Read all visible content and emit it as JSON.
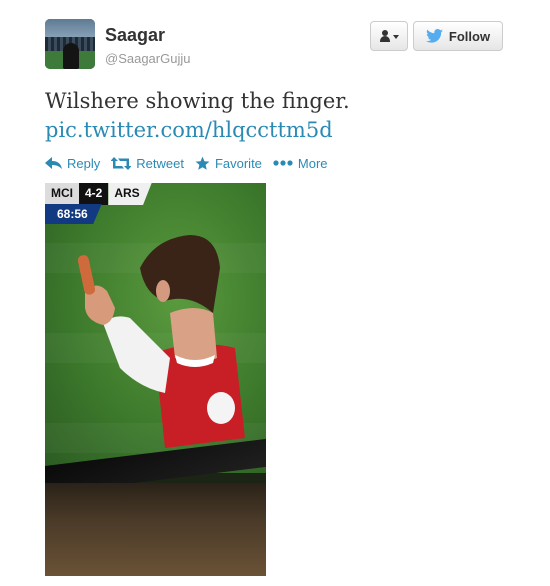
{
  "user": {
    "name": "Saagar",
    "handle": "@SaagarGujju"
  },
  "buttons": {
    "follow": "Follow"
  },
  "tweet": {
    "text": "Wilshere showing the finger.",
    "link": "pic.twitter.com/hlqccttm5d"
  },
  "actions": {
    "reply": "Reply",
    "retweet": "Retweet",
    "favorite": "Favorite",
    "more": "More"
  },
  "scoreboard": {
    "home": "MCI",
    "score": "4-2",
    "away": "ARS",
    "clock": "68:56"
  },
  "colors": {
    "link": "#2b8ab4",
    "twitter_bird": "#55acee",
    "text": "#333333",
    "muted": "#999999"
  }
}
